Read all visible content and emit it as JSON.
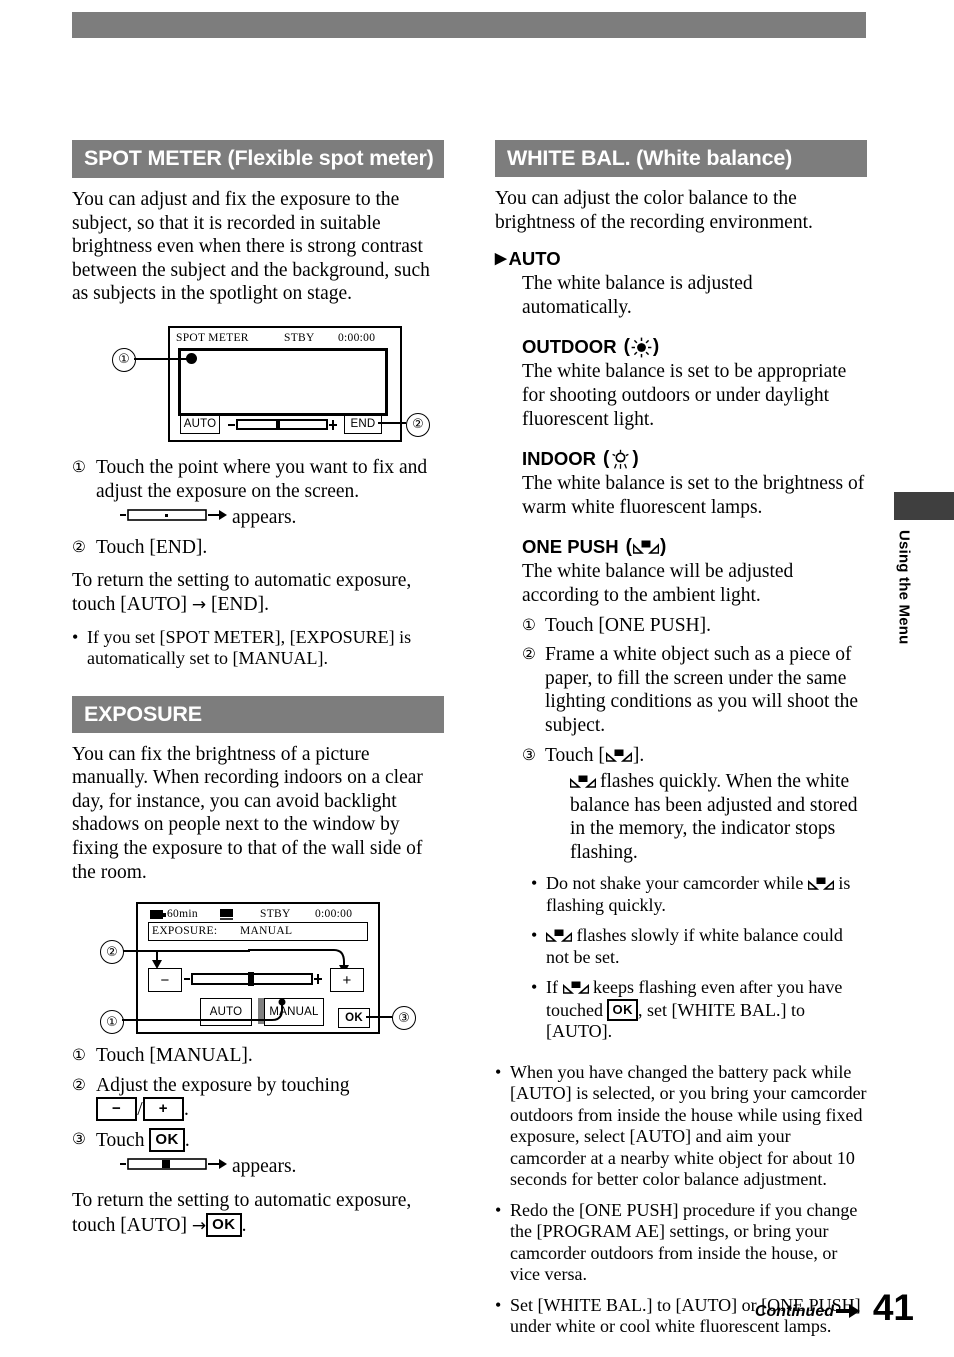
{
  "page": {
    "number": "41",
    "continued_label": "Continued",
    "continued_arrow": "→",
    "side_tab_label": "Using the Menu",
    "accent_gray": "#7d7d7d",
    "side_tab_dark": "#3f3f3f"
  },
  "left_column": {
    "spot_meter": {
      "heading": "SPOT METER (Flexible spot meter)",
      "intro": "You can adjust and fix the exposure to the subject, so that it is recorded in suitable brightness even when there is strong contrast between the subject and the background, such as subjects in the spotlight on stage.",
      "figure": {
        "name": "spot-meter-lcd",
        "osd_title": "SPOT METER",
        "osd_status": "STBY",
        "osd_timecode": "0:00:00",
        "button_auto": "AUTO",
        "button_end": "END",
        "callout_1": "①",
        "callout_2": "②"
      },
      "step1_num": "①",
      "step1": "Touch the point where you want to fix and adjust the exposure on the screen.",
      "appears_text": "appears.",
      "step2_num": "②",
      "step2": "Touch [END].",
      "return_text_a": "To return the setting to automatic exposure, touch [AUTO]",
      "return_arrow": "→",
      "return_text_b": "[END].",
      "note_bullet": "•",
      "note": "If you set [SPOT METER], [EXPOSURE] is automatically set to [MANUAL]."
    },
    "exposure": {
      "heading": "EXPOSURE",
      "intro": "You can fix the brightness of a picture manually. When recording indoors on a clear day, for instance, you can avoid backlight shadows on people next to the window by fixing the exposure to that of the wall side of the room.",
      "figure": {
        "name": "exposure-lcd",
        "osd_battery": "60min",
        "osd_status": "STBY",
        "osd_timecode": "0:00:00",
        "osd_row2_label": "EXPOSURE:",
        "osd_row2_value": "MANUAL",
        "button_minus": "−",
        "button_plus": "+",
        "button_auto": "AUTO",
        "button_manual": "MANUAL",
        "button_ok": "OK",
        "callout_1": "①",
        "callout_2": "②",
        "callout_3": "③"
      },
      "step1_num": "①",
      "step1": "Touch [MANUAL].",
      "step2_num": "②",
      "step2": "Adjust the exposure by touching",
      "step2_key_minus": "−",
      "step2_slash": "/",
      "step2_key_plus": "+",
      "step2_period": ".",
      "step3_num": "③",
      "step3_pre": "Touch",
      "step3_key_ok": "OK",
      "step3_period": ".",
      "appears_text": "appears.",
      "return_text_a": "To return the setting to automatic exposure, touch [AUTO]",
      "return_arrow": "→",
      "return_key_ok": "OK",
      "return_period": "."
    }
  },
  "right_column": {
    "white_bal": {
      "heading": "WHITE BAL. (White balance)",
      "intro": "You can adjust the color balance to the brightness of the recording environment.",
      "options": [
        {
          "marker": "▶",
          "title": "AUTO",
          "icon": "",
          "icon_name": "",
          "body": "The white balance is adjusted automatically."
        },
        {
          "marker": "",
          "title": "OUTDOOR",
          "icon": "(☀)",
          "icon_name": "sun-icon",
          "body": "The white balance is set to be appropriate for shooting outdoors or under daylight fluorescent light."
        },
        {
          "marker": "",
          "title": "INDOOR",
          "icon": "(☀)",
          "icon_name": "lightbulb-icon",
          "body": "The white balance is set to the brightness of warm white fluorescent lamps."
        },
        {
          "marker": "",
          "title": "ONE PUSH",
          "icon": "()",
          "icon_name": "one-push-wb-icon",
          "body": "The white balance will be adjusted according to the ambient light."
        }
      ],
      "one_push_steps": [
        {
          "num": "①",
          "text": "Touch [ONE PUSH]."
        },
        {
          "num": "②",
          "text": "Frame a white object such as a piece of paper, to fill the screen under the same lighting conditions as you will shoot the subject."
        }
      ],
      "step3_num": "③",
      "step3_pre": "Touch [",
      "step3_post": "].",
      "step3_detail": "flashes quickly. When the white balance has been adjusted and stored in the memory, the indicator stops flashing.",
      "sub_bullets": [
        {
          "bullet": "•",
          "pre": "Do not shake your camcorder while",
          "post": "is flashing quickly."
        },
        {
          "bullet": "•",
          "pre": "",
          "post": "flashes slowly if white balance could not be set."
        },
        {
          "bullet": "•",
          "pre": "If",
          "mid": "keeps flashing even after you have touched",
          "key": "OK",
          "post": ", set [WHITE BAL.] to [AUTO]."
        }
      ],
      "notes": [
        {
          "bullet": "•",
          "text": "When you have changed the battery pack while [AUTO] is selected, or you bring your camcorder outdoors from inside the house while using fixed exposure, select [AUTO] and aim your camcorder at a nearby white object for about 10 seconds for better color balance adjustment."
        },
        {
          "bullet": "•",
          "text": "Redo the [ONE PUSH] procedure if you change the [PROGRAM AE] settings, or bring your camcorder outdoors from inside the house, or vice versa."
        },
        {
          "bullet": "•",
          "text": "Set [WHITE BAL.] to [AUTO] or [ONE PUSH] under white or cool white fluorescent lamps."
        }
      ]
    }
  }
}
